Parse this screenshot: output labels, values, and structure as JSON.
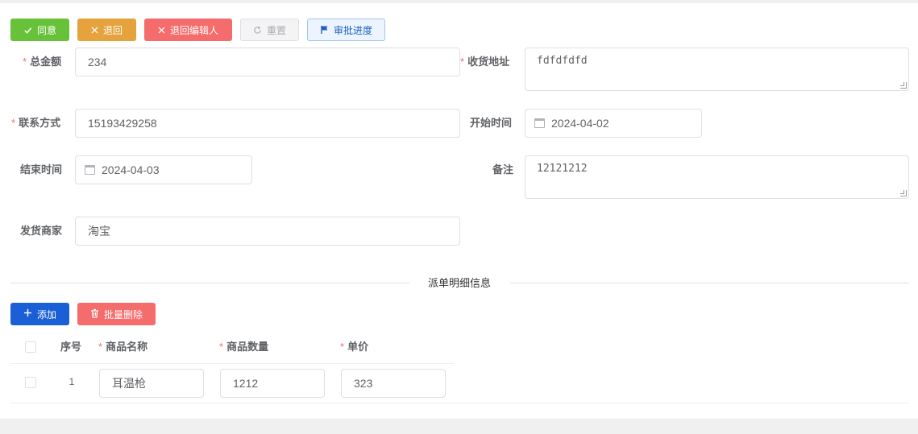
{
  "toolbar": {
    "agree": "同意",
    "back": "退回",
    "back_to_editor": "退回编辑人",
    "reset": "重置",
    "approval_progress": "审批进度"
  },
  "form": {
    "total_amount": {
      "label": "总金额",
      "value": "234",
      "required": true
    },
    "shipping_address": {
      "label": "收货地址",
      "value": "fdfdfdfd",
      "required": true
    },
    "contact": {
      "label": "联系方式",
      "value": "15193429258",
      "required": true
    },
    "start_time": {
      "label": "开始时间",
      "value": "2024-04-02"
    },
    "end_time": {
      "label": "结束时间",
      "value": "2024-04-03"
    },
    "remark": {
      "label": "备注",
      "value": "12121212"
    },
    "seller": {
      "label": "发货商家",
      "value": "淘宝"
    }
  },
  "section": {
    "title": "派单明细信息"
  },
  "detail_toolbar": {
    "add": "添加",
    "batch_delete": "批量删除"
  },
  "table": {
    "headers": {
      "index": "序号",
      "name": "商品名称",
      "qty": "商品数量",
      "price": "单价"
    },
    "rows": [
      {
        "index": "1",
        "name": "耳温枪",
        "qty": "1212",
        "price": "323"
      }
    ]
  },
  "colors": {
    "agree": "#67c23a",
    "back": "#e6a23c",
    "danger": "#f56c6c",
    "primary": "#1a5fd6"
  },
  "icons": {
    "agree": "check-icon",
    "back": "close-icon",
    "reset": "refresh-icon",
    "progress": "flag-icon",
    "add": "plus-icon",
    "batch_delete": "trash-icon",
    "date": "calendar-icon"
  }
}
